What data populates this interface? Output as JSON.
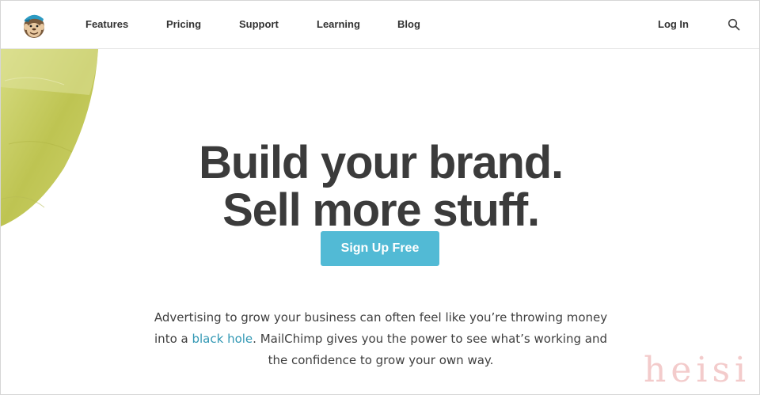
{
  "header": {
    "logo": {
      "icon": "chimp-logo-icon",
      "alt": ""
    },
    "nav": [
      {
        "label": "Features"
      },
      {
        "label": "Pricing"
      },
      {
        "label": "Support"
      },
      {
        "label": "Learning"
      },
      {
        "label": "Blog"
      }
    ],
    "login_label": "Log In",
    "search_icon": "search-icon"
  },
  "hero": {
    "headline_line1": "Build your brand.",
    "headline_line2": "Sell more stuff.",
    "cta_label": "Sign Up Free",
    "intro_before": "Advertising to grow your business can often feel like you’re throwing money into a ",
    "intro_link": "black hole",
    "intro_after": ". MailChimp gives you the power to see what’s working and the confidence to grow your own way."
  },
  "watermark": "heisi",
  "colors": {
    "accent": "#52bad5",
    "link": "#3298b4",
    "headline": "#3b3b3b",
    "blob": "#c9cf63"
  }
}
